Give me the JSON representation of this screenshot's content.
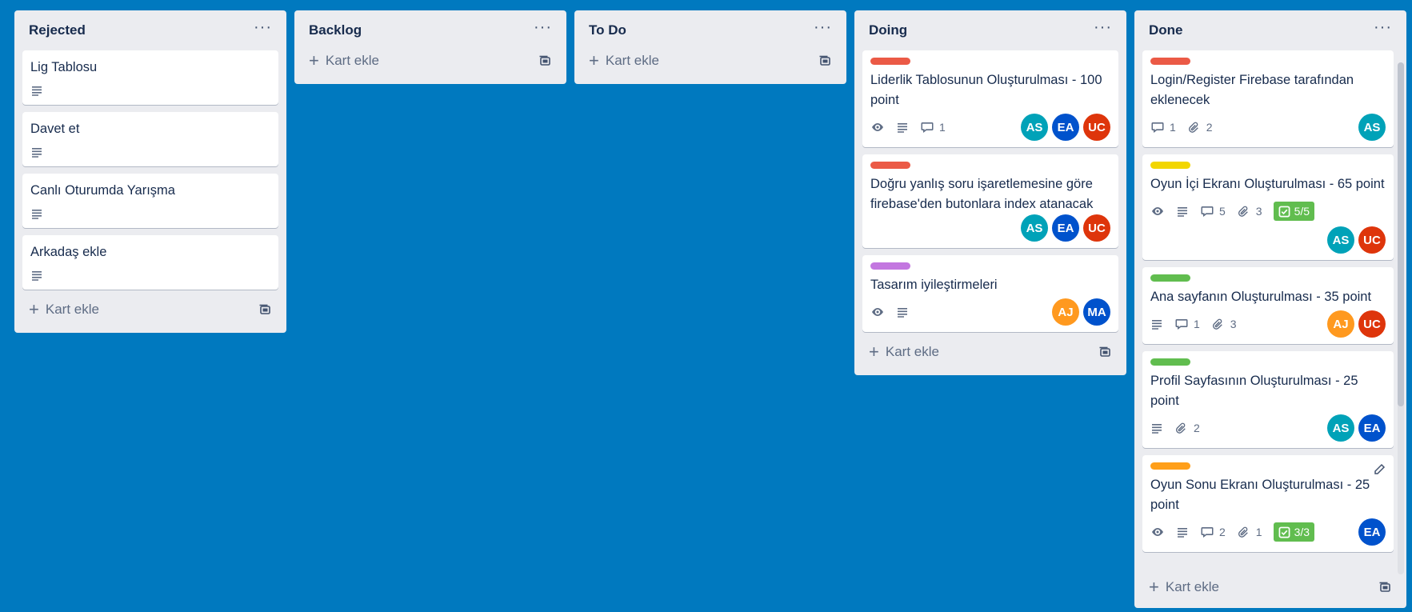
{
  "colors": {
    "board_bg": "#0079bf",
    "label_red": "#eb5a46",
    "label_yellow": "#f2d600",
    "label_purple": "#c377e0",
    "label_green": "#61bd4f",
    "label_orange": "#ff9f1a",
    "avatar_AS": "#00a2b8",
    "avatar_EA": "#0052cc",
    "avatar_UC": "#de350b",
    "avatar_AJ": "#ff991f",
    "avatar_MA": "#0052cc"
  },
  "add_card_label": "Kart ekle",
  "lists": {
    "rejected": {
      "title": "Rejected",
      "cards": [
        {
          "title": "Lig Tablosu"
        },
        {
          "title": "Davet et"
        },
        {
          "title": "Canlı Oturumda Yarışma"
        },
        {
          "title": "Arkadaş ekle"
        }
      ]
    },
    "backlog": {
      "title": "Backlog"
    },
    "todo": {
      "title": "To Do"
    },
    "doing": {
      "title": "Doing",
      "cards": [
        {
          "title": "Liderlik Tablosunun Oluşturulması - 100 point",
          "comments": "1",
          "members": [
            "AS",
            "EA",
            "UC"
          ]
        },
        {
          "title": "Doğru yanlış soru işaretlemesine göre firebase'den butonlara index atanacak",
          "members": [
            "AS",
            "EA",
            "UC"
          ]
        },
        {
          "title": "Tasarım iyileştirmeleri",
          "members": [
            "AJ",
            "MA"
          ]
        }
      ]
    },
    "done": {
      "title": "Done",
      "cards": [
        {
          "title": "Login/Register Firebase tarafından eklenecek",
          "comments": "1",
          "attachments": "2",
          "members": [
            "AS"
          ]
        },
        {
          "title": "Oyun İçi Ekranı Oluşturulması - 65 point",
          "comments": "5",
          "attachments": "3",
          "checklist": "5/5",
          "members": [
            "AS",
            "UC"
          ]
        },
        {
          "title": "Ana sayfanın Oluşturulması - 35 point",
          "comments": "1",
          "attachments": "3",
          "members": [
            "AJ",
            "UC"
          ]
        },
        {
          "title": "Profil Sayfasının Oluşturulması - 25 point",
          "attachments": "2",
          "members": [
            "AS",
            "EA"
          ]
        },
        {
          "title": "Oyun Sonu Ekranı Oluşturulması - 25 point",
          "comments": "2",
          "attachments": "1",
          "checklist": "3/3",
          "members": [
            "EA"
          ]
        }
      ]
    }
  },
  "avatars": {
    "AS": "AS",
    "EA": "EA",
    "UC": "UC",
    "AJ": "AJ",
    "MA": "MA"
  }
}
